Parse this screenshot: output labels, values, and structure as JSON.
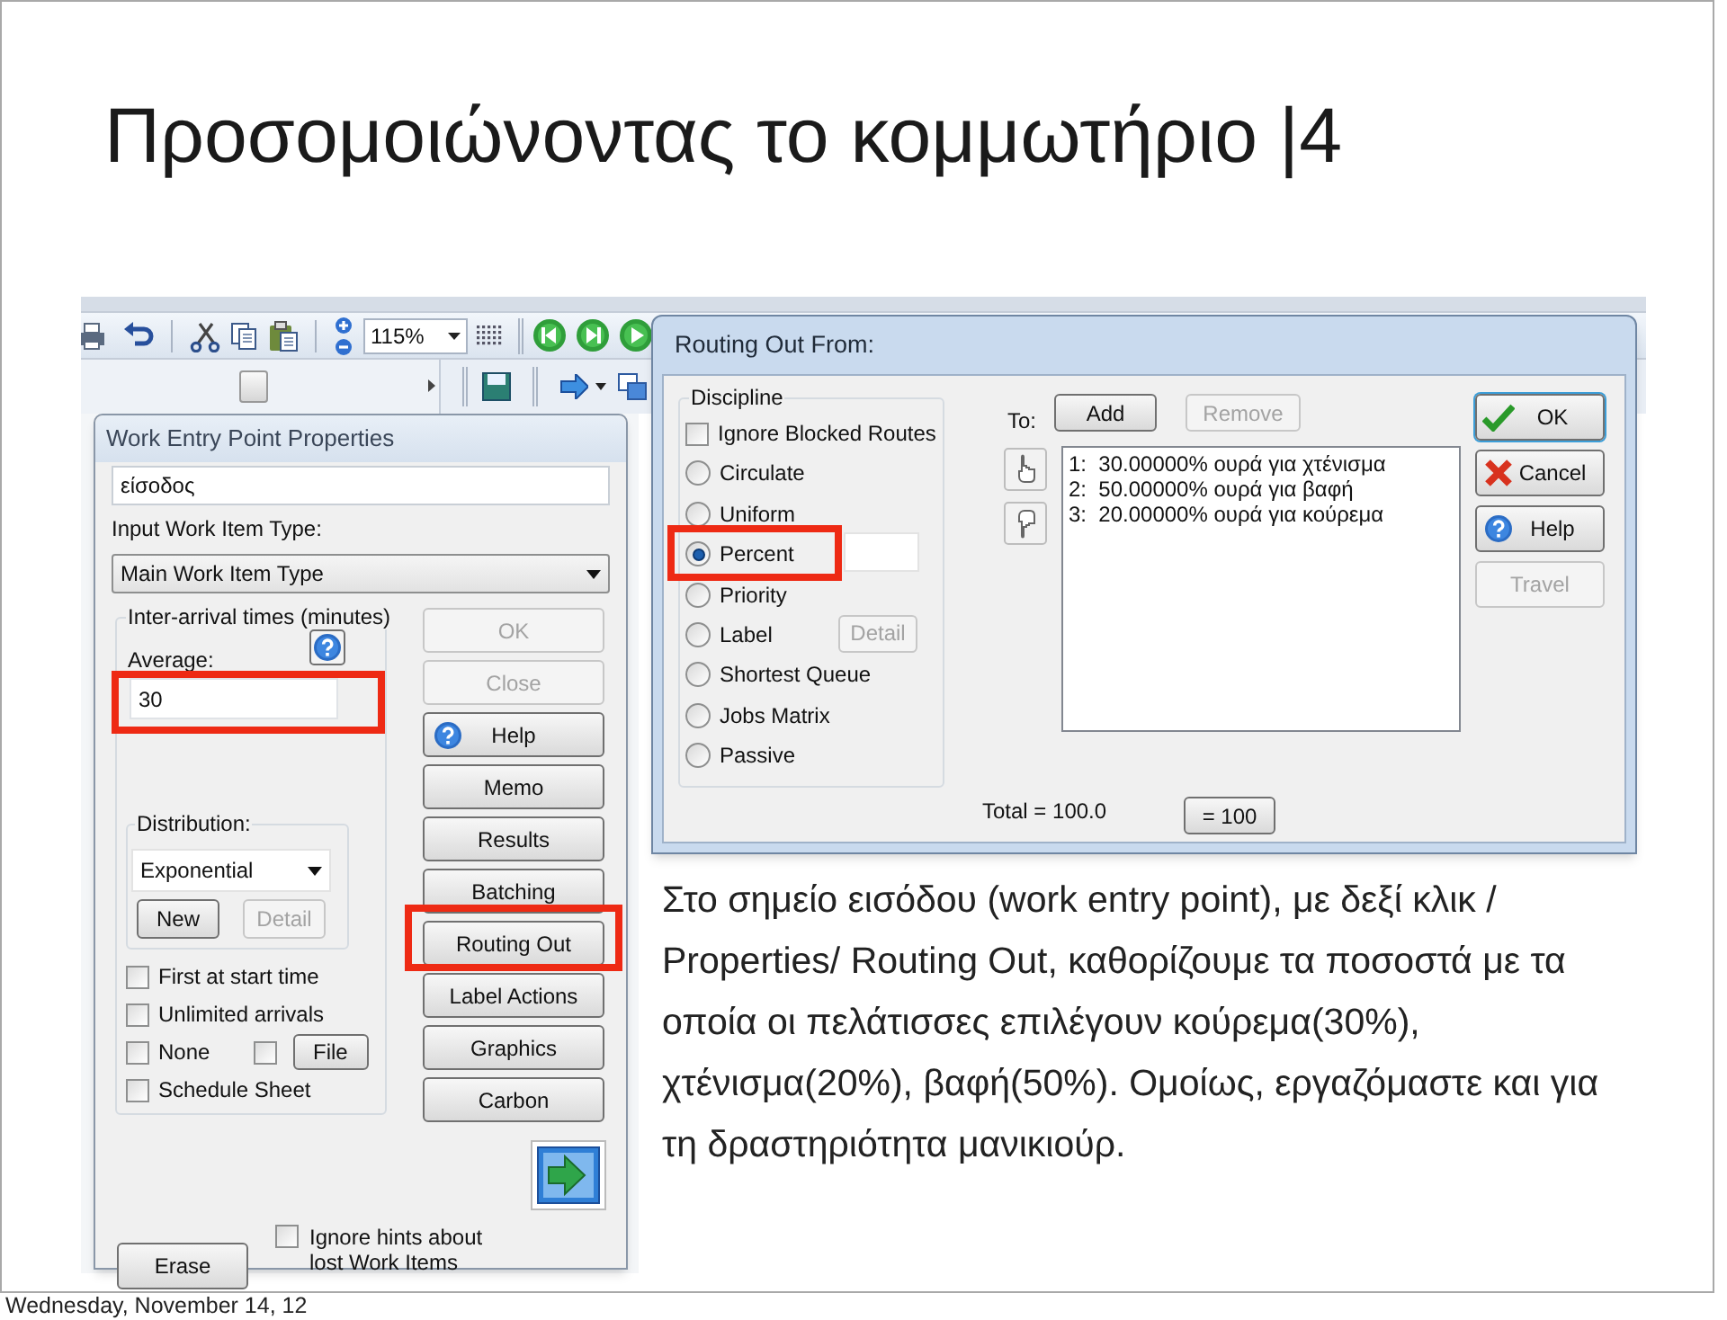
{
  "slide": {
    "title": "Προσομοιώνοντας το κομμωτήριο |4",
    "caption": "Στο σημείο εισόδου (work entry point), με δεξί κλικ / Properties/ Routing Out, καθορίζουμε τα ποσοστά με τα οποία οι πελάτισσες επιλέγουν κούρεμα(30%), χτένισμα(20%), βαφή(50%). Ομοίως, εργαζόμαστε και για τη δραστηριότητα μανικιούρ.",
    "footer_date": "Wednesday, November 14, 12"
  },
  "toolbar": {
    "zoom": "115%"
  },
  "work_entry": {
    "title": "Work Entry Point Properties",
    "name_value": "είσοδος",
    "input_type_label": "Input Work Item Type:",
    "input_type_value": "Main Work Item Type",
    "inter_arrival": {
      "legend": "Inter-arrival times (minutes)",
      "average_label": "Average:",
      "average_value": "30",
      "highlighted": true
    },
    "distribution": {
      "legend": "Distribution:",
      "value": "Exponential",
      "buttons": [
        {
          "label": "New",
          "disabled": false
        },
        {
          "label": "Detail",
          "disabled": true
        }
      ]
    },
    "options": [
      {
        "label": "First at start time",
        "checked": false
      },
      {
        "label": "Unlimited arrivals",
        "checked": false
      },
      {
        "label": "None",
        "checked": false,
        "extra": {
          "checked": false,
          "button": "File"
        }
      },
      {
        "label": "Schedule Sheet",
        "checked": false
      }
    ],
    "side_buttons": [
      {
        "label": "OK",
        "kind": "plain",
        "disabled": true,
        "highlighted": false
      },
      {
        "label": "Close",
        "kind": "plain",
        "disabled": true,
        "highlighted": false
      },
      {
        "label": "Help",
        "kind": "help",
        "disabled": false,
        "highlighted": false
      },
      {
        "label": "Memo",
        "kind": "plain",
        "disabled": false,
        "highlighted": false
      },
      {
        "label": "Results",
        "kind": "plain",
        "disabled": false,
        "highlighted": false
      },
      {
        "label": "Batching",
        "kind": "plain",
        "disabled": false,
        "highlighted": false
      },
      {
        "label": "Routing Out",
        "kind": "plain",
        "disabled": false,
        "highlighted": true
      },
      {
        "label": "Label Actions",
        "kind": "plain",
        "disabled": false,
        "highlighted": false
      },
      {
        "label": "Graphics",
        "kind": "plain",
        "disabled": false,
        "highlighted": false
      },
      {
        "label": "Carbon",
        "kind": "plain",
        "disabled": false,
        "highlighted": false
      }
    ],
    "erase_button": "Erase",
    "ignore_hints": {
      "label": "Ignore hints about lost Work Items",
      "checked": false
    }
  },
  "routing": {
    "title": "Routing Out From:",
    "discipline_legend": "Discipline",
    "ignore_blocked": {
      "label": "Ignore Blocked Routes",
      "checked": false
    },
    "disciplines": [
      {
        "label": "Circulate",
        "selected": false,
        "highlighted": false
      },
      {
        "label": "Uniform",
        "selected": false,
        "highlighted": false
      },
      {
        "label": "Percent",
        "selected": true,
        "highlighted": true,
        "kind": "field"
      },
      {
        "label": "Priority",
        "selected": false,
        "highlighted": false
      },
      {
        "label": "Label",
        "selected": false,
        "highlighted": false,
        "kind": "detail",
        "button": "Detail"
      },
      {
        "label": "Shortest Queue",
        "selected": false,
        "highlighted": false
      },
      {
        "label": "Jobs Matrix",
        "selected": false,
        "highlighted": false
      },
      {
        "label": "Passive",
        "selected": false,
        "highlighted": false
      }
    ],
    "to_label": "To:",
    "add_button": {
      "label": "Add",
      "disabled": false
    },
    "remove_button": {
      "label": "Remove",
      "disabled": true
    },
    "routes": [
      "1:  30.00000% ουρά για χτένισμα",
      "2:  50.00000% ουρά για βαφή",
      "3:  20.00000% ουρά για κούρεμα"
    ],
    "total": "Total = 100.0",
    "equal_button": "= 100",
    "buttons": [
      {
        "label": "OK",
        "kind": "ok",
        "disabled": false
      },
      {
        "label": "Cancel",
        "kind": "cancel",
        "disabled": false
      },
      {
        "label": "Help",
        "kind": "help",
        "disabled": false
      },
      {
        "label": "Travel",
        "kind": "plain",
        "disabled": true
      }
    ]
  }
}
